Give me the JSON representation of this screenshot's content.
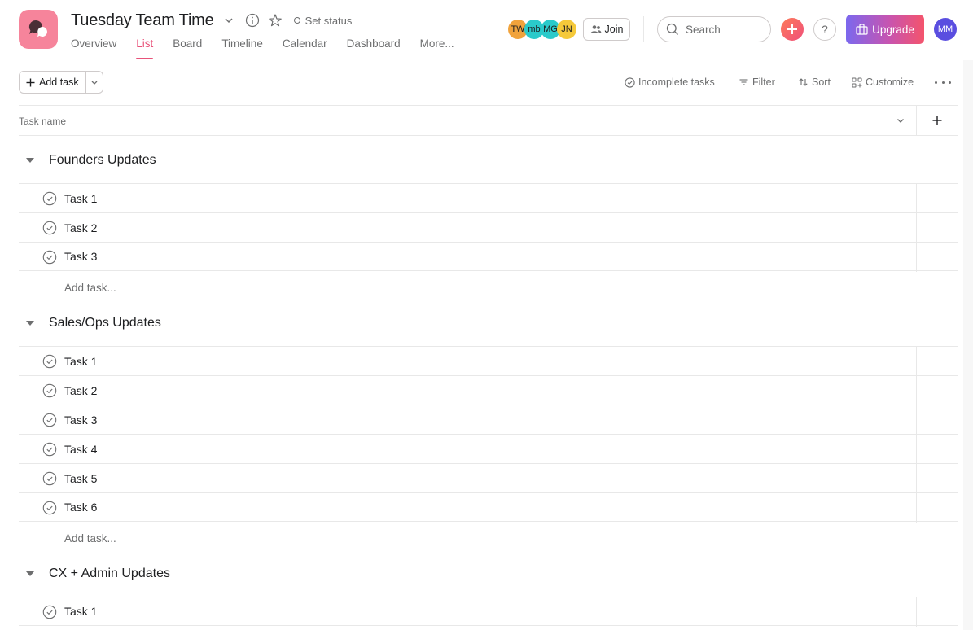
{
  "header": {
    "project_title": "Tuesday Team Time",
    "set_status_label": "Set status",
    "tabs": [
      {
        "label": "Overview",
        "active": false
      },
      {
        "label": "List",
        "active": true
      },
      {
        "label": "Board",
        "active": false
      },
      {
        "label": "Timeline",
        "active": false
      },
      {
        "label": "Calendar",
        "active": false
      },
      {
        "label": "Dashboard",
        "active": false
      },
      {
        "label": "More..."
      }
    ],
    "members": [
      {
        "initials": "TW",
        "color": "#f1a33c"
      },
      {
        "initials": "mb",
        "color": "#2bcaca"
      },
      {
        "initials": "MG",
        "color": "#2bcaca"
      },
      {
        "initials": "JN",
        "color": "#f5c93a"
      }
    ],
    "join_label": "Join",
    "search_placeholder": "Search",
    "help_label": "?",
    "upgrade_label": "Upgrade",
    "user_initials": "MM"
  },
  "toolbar": {
    "add_task_label": "Add task",
    "incomplete_label": "Incomplete tasks",
    "filter_label": "Filter",
    "sort_label": "Sort",
    "customize_label": "Customize"
  },
  "columns": {
    "task_name": "Task name"
  },
  "sections": [
    {
      "title": "Founders Updates",
      "tasks": [
        "Task 1",
        "Task 2",
        "Task 3"
      ],
      "add_task_label": "Add task..."
    },
    {
      "title": "Sales/Ops Updates",
      "tasks": [
        "Task 1",
        "Task 2",
        "Task 3",
        "Task 4",
        "Task 5",
        "Task 6"
      ],
      "add_task_label": "Add task..."
    },
    {
      "title": "CX + Admin Updates",
      "tasks": [
        "Task 1"
      ]
    }
  ],
  "colors": {
    "accent": "#e8537a",
    "project_icon": "#f6849b",
    "user_avatar": "#5a4ee0"
  }
}
